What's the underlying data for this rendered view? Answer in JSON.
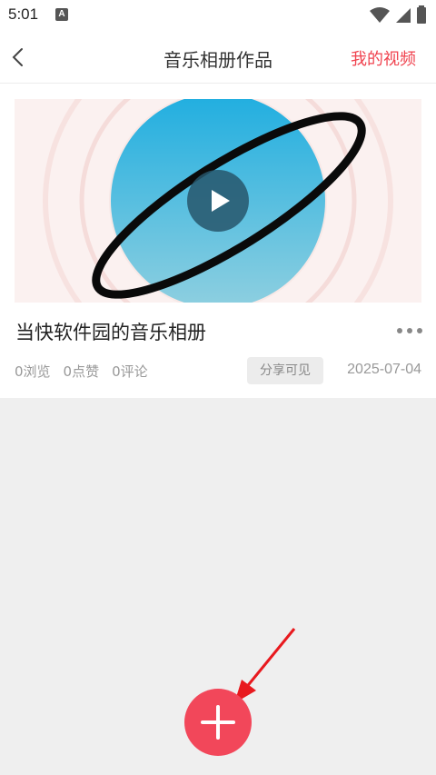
{
  "status_bar": {
    "time": "5:01",
    "notification_letter": "A",
    "icons": [
      "wifi-icon",
      "signal-icon",
      "battery-icon"
    ]
  },
  "header": {
    "title": "音乐相册作品",
    "right_link": "我的视频"
  },
  "card": {
    "title": "当快软件园的音乐相册",
    "views": "0浏览",
    "likes": "0点赞",
    "comments": "0评论",
    "visibility": "分享可见",
    "date": "2025-07-04"
  },
  "colors": {
    "accent": "#f2475a",
    "link_red": "#f0434f",
    "background": "#efefef"
  }
}
